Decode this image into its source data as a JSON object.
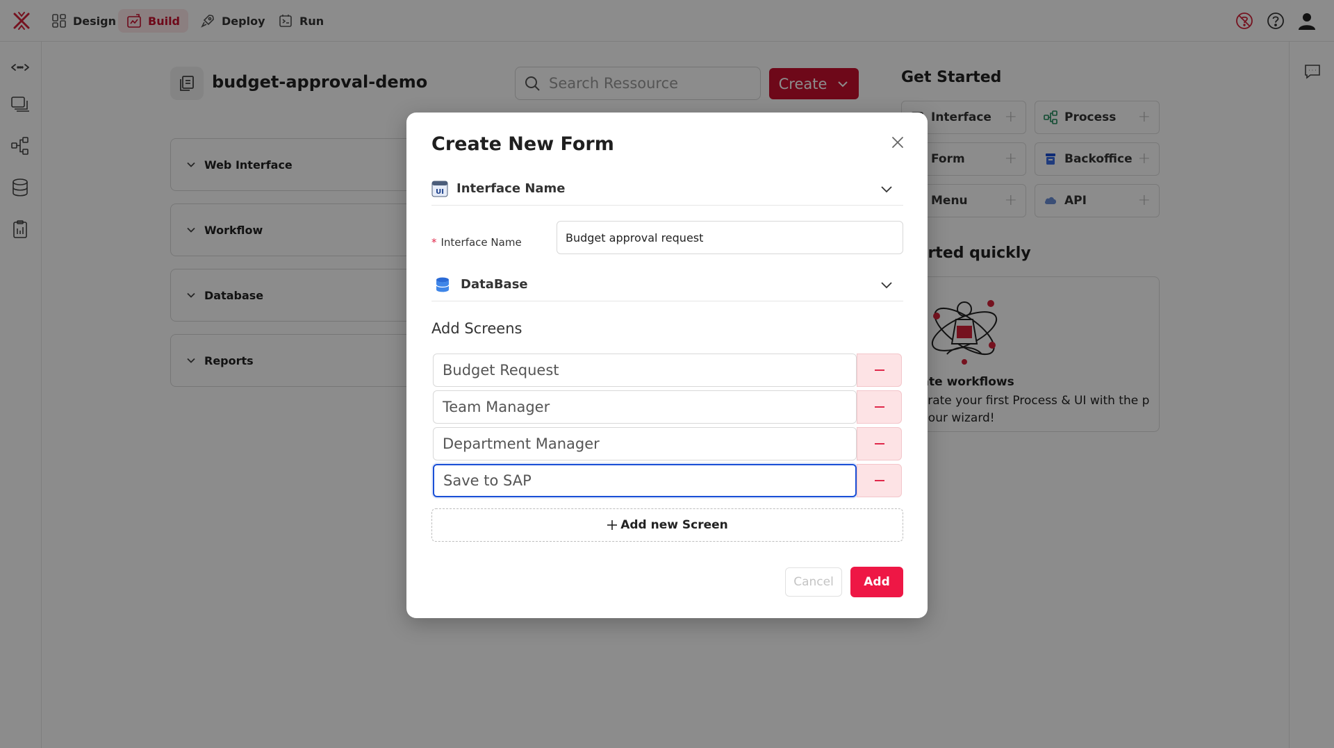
{
  "nav": {
    "items": [
      {
        "label": "Design",
        "icon": "design-icon"
      },
      {
        "label": "Build",
        "icon": "build-icon",
        "active": true
      },
      {
        "label": "Deploy",
        "icon": "deploy-icon"
      },
      {
        "label": "Run",
        "icon": "run-icon"
      }
    ]
  },
  "project": {
    "title": "budget-approval-demo"
  },
  "search": {
    "placeholder": "Search Ressource"
  },
  "create_button": {
    "label": "Create"
  },
  "sections": [
    {
      "label": "Web Interface"
    },
    {
      "label": "Workflow"
    },
    {
      "label": "Database"
    },
    {
      "label": "Reports"
    }
  ],
  "get_started": {
    "title": "Get Started",
    "cards": [
      {
        "label": "Interface",
        "icon": "interface-icon"
      },
      {
        "label": "Process",
        "icon": "process-icon"
      },
      {
        "label": "Form",
        "icon": "form-icon"
      },
      {
        "label": "Backoffice",
        "icon": "backoffice-icon"
      },
      {
        "label": "Menu",
        "icon": "menu-icon"
      },
      {
        "label": "API",
        "icon": "api-icon"
      }
    ],
    "subtitle": "started quickly",
    "wizard_title": "eate workflows",
    "wizard_text": "nerate your first Process & UI with the p of our wizard!"
  },
  "modal": {
    "title": "Create New Form",
    "interface_section": "Interface Name",
    "interface_badge": "UI",
    "field_label": "Interface Name",
    "field_value": "Budget approval request",
    "database_section": "DataBase",
    "screens_title": "Add Screens",
    "screens": [
      "Budget Request",
      "Team Manager",
      "Department Manager",
      "Save to SAP"
    ],
    "add_screen_label": "Add new Screen",
    "cancel_label": "Cancel",
    "add_label": "Add"
  },
  "colors": {
    "brand": "#c8102e",
    "add_button": "#ee1745",
    "focus": "#1a4fd6",
    "remove_bg": "#fde3e5"
  }
}
